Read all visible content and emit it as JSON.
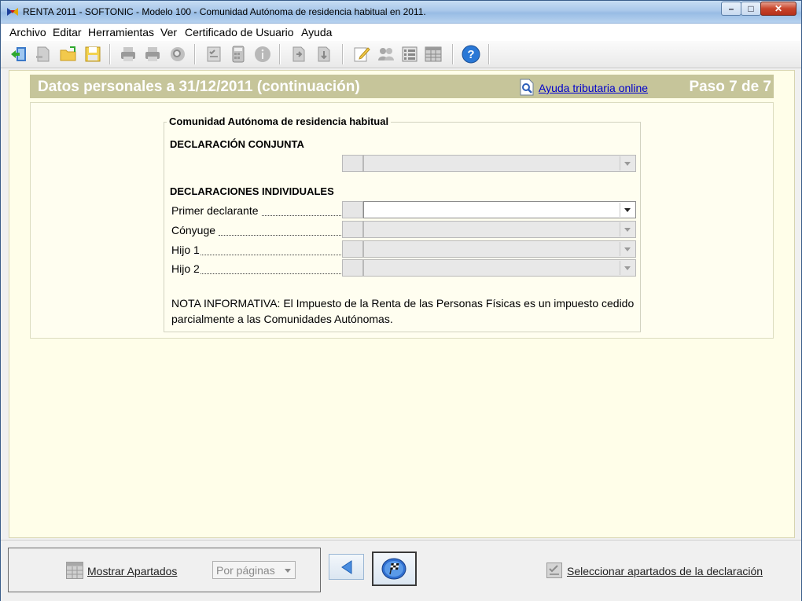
{
  "window": {
    "title": "RENTA 2011 - SOFTONIC - Modelo 100 - Comunidad Autónoma de residencia habitual en 2011."
  },
  "menu": {
    "items": [
      "Archivo",
      "Editar",
      "Herramientas",
      "Ver",
      "Certificado de Usuario",
      "Ayuda"
    ]
  },
  "toolbar": {
    "icons": [
      "exit-icon",
      "new-icon",
      "open-folder-icon",
      "save-icon",
      "print-icon",
      "print-preview-icon",
      "search-icon",
      "checklist-icon",
      "calculator-icon",
      "info-icon",
      "export-icon",
      "import-icon",
      "edit-icon",
      "users-icon",
      "list-icon",
      "grid-icon",
      "help-icon"
    ]
  },
  "header": {
    "title": "Datos personales a 31/12/2011 (continuación)",
    "help_link": "Ayuda tributaria online",
    "step": "Paso 7 de 7"
  },
  "form": {
    "group_title": "Comunidad Autónoma de residencia habitual",
    "joint_section": "DECLARACIÓN CONJUNTA",
    "individual_section": "DECLARACIONES INDIVIDUALES",
    "rows": [
      {
        "label": "Primer declarante",
        "value": ""
      },
      {
        "label": "Cónyuge",
        "value": ""
      },
      {
        "label": "Hijo 1",
        "value": ""
      },
      {
        "label": "Hijo 2",
        "value": ""
      }
    ],
    "note": "NOTA INFORMATIVA: El Impuesto de la Renta de las Personas Físicas es un impuesto cedido parcialmente a las Comunidades Autónomas."
  },
  "bottom": {
    "show_sections": "Mostrar Apartados",
    "view_mode": "Por páginas",
    "select_sections": "Seleccionar apartados de la declaración"
  },
  "colors": {
    "header_bg": "#c6c59a",
    "page_bg": "#fffee9",
    "link": "#0000cc"
  }
}
